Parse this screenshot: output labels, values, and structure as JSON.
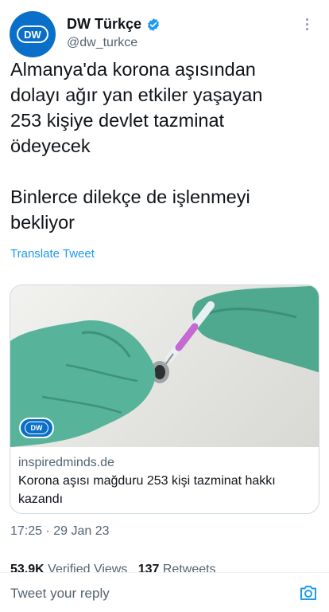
{
  "header": {
    "display_name": "DW Türkçe",
    "handle": "@dw_turkce",
    "avatar_logo": "DW",
    "icons": {
      "verified": "verified-badge-icon",
      "more": "more-vertical-icon"
    }
  },
  "tweet": {
    "text_line1": "Almanya'da korona aşısından",
    "text_line2": "dolayı ağır yan etkiler yaşayan",
    "text_line3": "253 kişiye devlet tazminat",
    "text_line4": "ödeyecek",
    "text_line5": "Binlerce dilekçe de işlenmeyi",
    "text_line6": "bekliyor",
    "translate_label": "Translate Tweet"
  },
  "card": {
    "logo": "DW",
    "domain": "inspiredminds.de",
    "title": "Korona aşısı mağduru 253 kişi tazminat hakkı kazandı"
  },
  "meta": {
    "timestamp": "17:25 · 29 Jan 23",
    "views_count": "53,9K",
    "views_label": "Verified Views",
    "retweets_count": "137",
    "retweets_label": "Retweets"
  },
  "reply": {
    "placeholder": "Tweet your reply",
    "icons": {
      "camera": "camera-icon"
    }
  },
  "colors": {
    "accent": "#1d9bf0",
    "dw_blue": "#0a6fc9",
    "text_primary": "#0f1419",
    "text_secondary": "#536471"
  }
}
